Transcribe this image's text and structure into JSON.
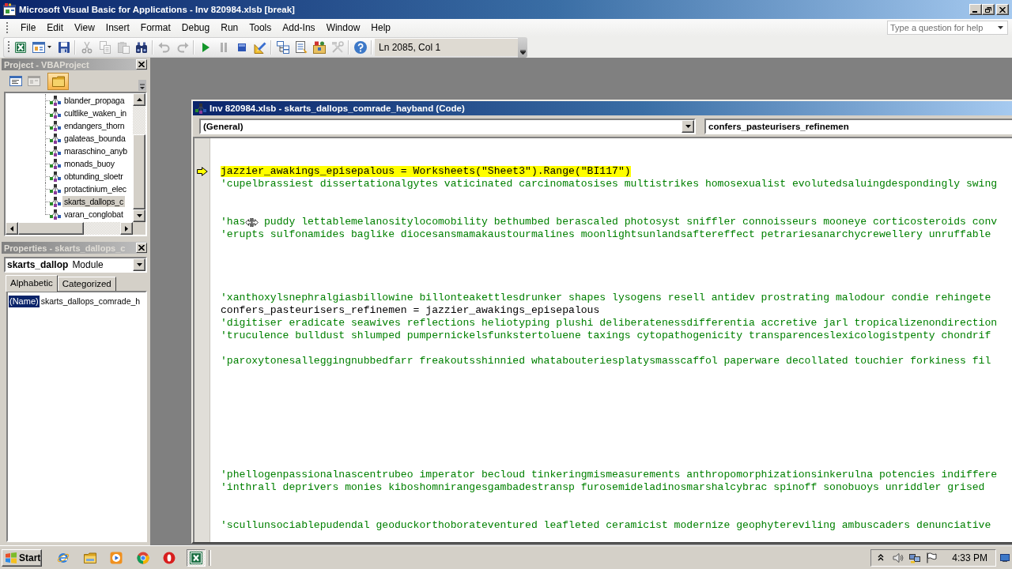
{
  "window": {
    "title": "Microsoft Visual Basic for Applications - Inv 820984.xlsb [break]"
  },
  "menu": [
    "File",
    "Edit",
    "View",
    "Insert",
    "Format",
    "Debug",
    "Run",
    "Tools",
    "Add-Ins",
    "Window",
    "Help"
  ],
  "help_box": {
    "placeholder": "Type a question for help"
  },
  "toolbar": {
    "buttons": [
      {
        "disabled": false
      },
      {
        "disabled": false
      },
      {
        "disabled": false
      },
      {
        "disabled": true
      },
      {
        "disabled": true
      },
      {
        "disabled": true
      },
      {
        "disabled": false
      },
      {
        "disabled": true
      },
      {
        "disabled": true
      },
      {
        "disabled": false
      },
      {
        "disabled": true
      },
      {
        "disabled": false
      },
      {
        "disabled": false
      },
      {
        "disabled": false
      },
      {
        "disabled": false
      },
      {
        "disabled": false
      },
      {
        "disabled": true
      },
      {
        "disabled": false
      }
    ],
    "position": "Ln 2085, Col 1"
  },
  "project_panel": {
    "title": "Project - VBAProject",
    "view_buttons": [
      {
        "on": false,
        "disabled": false
      },
      {
        "on": false,
        "disabled": true
      },
      {
        "on": true,
        "disabled": false
      }
    ],
    "tree": [
      {
        "label": "blander_propaga",
        "selected": false
      },
      {
        "label": "cultlike_waken_in",
        "selected": false
      },
      {
        "label": "endangers_thorn",
        "selected": false
      },
      {
        "label": "galateas_bounda",
        "selected": false
      },
      {
        "label": "maraschino_anyb",
        "selected": false
      },
      {
        "label": "monads_buoy",
        "selected": false
      },
      {
        "label": "obtunding_sloetr",
        "selected": false
      },
      {
        "label": "protactinium_elec",
        "selected": false
      },
      {
        "label": "skarts_dallops_c",
        "selected": true
      },
      {
        "label": "varan_conglobat",
        "selected": false
      }
    ]
  },
  "properties_panel": {
    "title": "Properties - skarts_dallops_c",
    "object": {
      "name": "skarts_dallop",
      "type": "Module"
    },
    "tabs": [
      {
        "label": "Alphabetic",
        "selected": true
      },
      {
        "label": "Categorized",
        "selected": false
      }
    ],
    "rows": [
      {
        "name": "(Name)",
        "value": "skarts_dallops_comrade_h",
        "selected": true
      }
    ]
  },
  "code_window": {
    "title": "Inv 820984.xlsb - skarts_dallops_comrade_hayband (Code)",
    "object_box": "(General)",
    "procedure_box": "confers_pasteurisers_refinemen",
    "lines": [
      {
        "kind": "blank",
        "current": false
      },
      {
        "kind": "blank",
        "current": false
      },
      {
        "kind": "code",
        "current": true,
        "text": "jazzier_awakings_episepalous = Worksheets(\"Sheet3\").Range(\"BI117\")"
      },
      {
        "kind": "comment",
        "current": false,
        "text": "'cupelbrassiest dissertationalgytes vaticinated carcinomatosises multistrikes homosexualist evolutedsaluingdespondingly swing"
      },
      {
        "kind": "blank",
        "current": false
      },
      {
        "kind": "blank",
        "current": false
      },
      {
        "kind": "comment",
        "current": false,
        "text": "'has",
        "text_after_pointer": "puddy lettablemelanositylocomobility bethumbed berascaled photosyst sniffler connoisseurs mooneye corticosteroids conv"
      },
      {
        "kind": "comment",
        "current": false,
        "text": "'erupts sulfonamides baglike diocesansmamakaustourmalines moonlightsunlandsaftereffect petrariesanarchycrewellery unruffable"
      },
      {
        "kind": "blank",
        "current": false
      },
      {
        "kind": "blank",
        "current": false
      },
      {
        "kind": "blank",
        "current": false
      },
      {
        "kind": "blank",
        "current": false
      },
      {
        "kind": "comment",
        "current": false,
        "text": "'xanthoxylsnephralgiasbillowine billonteakettlesdrunker shapes lysogens resell antidev prostrating malodour condie rehingete"
      },
      {
        "kind": "code",
        "current": false,
        "text": "confers_pasteurisers_refinemen = jazzier_awakings_episepalous"
      },
      {
        "kind": "comment",
        "current": false,
        "text": "'digitiser eradicate seawives reflections heliotyping plushi deliberatenessdifferentia accretive jarl tropicalizenondirection"
      },
      {
        "kind": "comment",
        "current": false,
        "text": "'truculence bulldust shlumped pumpernickelsfunkstertoluene taxings cytopathogenicity transparenceslexicologistpenty chondrif"
      },
      {
        "kind": "blank",
        "current": false
      },
      {
        "kind": "comment",
        "current": false,
        "text": "'paroxytonesalleggingnubbedfarr freakoutsshinnied whatabouteriesplatysmasscaffol paperware decollated touchier forkiness fil"
      },
      {
        "kind": "blank",
        "current": false
      },
      {
        "kind": "blank",
        "current": false
      },
      {
        "kind": "blank",
        "current": false
      },
      {
        "kind": "blank",
        "current": false
      },
      {
        "kind": "blank",
        "current": false
      },
      {
        "kind": "blank",
        "current": false
      },
      {
        "kind": "blank",
        "current": false
      },
      {
        "kind": "blank",
        "current": false
      },
      {
        "kind": "comment",
        "current": false,
        "text": "'phellogenpassionalnascentrubeo imperator becloud tinkeringmismeasurements anthropomorphizationsinkerulna potencies indiffere"
      },
      {
        "kind": "comment",
        "current": false,
        "text": "'inthrall deprivers monies kiboshomnirangesgambadestransp furosemideladinosmarshalcybrac spinoff sonobuoys unriddler grised"
      },
      {
        "kind": "blank",
        "current": false
      },
      {
        "kind": "blank",
        "current": false
      },
      {
        "kind": "comment",
        "current": false,
        "text": "'scullunsociablepudendal geoduckorthoborateventured leafleted ceramicist modernize geophytereviling ambuscaders denunciative"
      }
    ]
  },
  "taskbar": {
    "start": "Start",
    "apps": [
      {
        "selected": false
      },
      {
        "selected": false
      },
      {
        "selected": false
      },
      {
        "selected": false
      },
      {
        "selected": false
      },
      {
        "selected": true
      }
    ],
    "clock": "4:33 PM"
  }
}
